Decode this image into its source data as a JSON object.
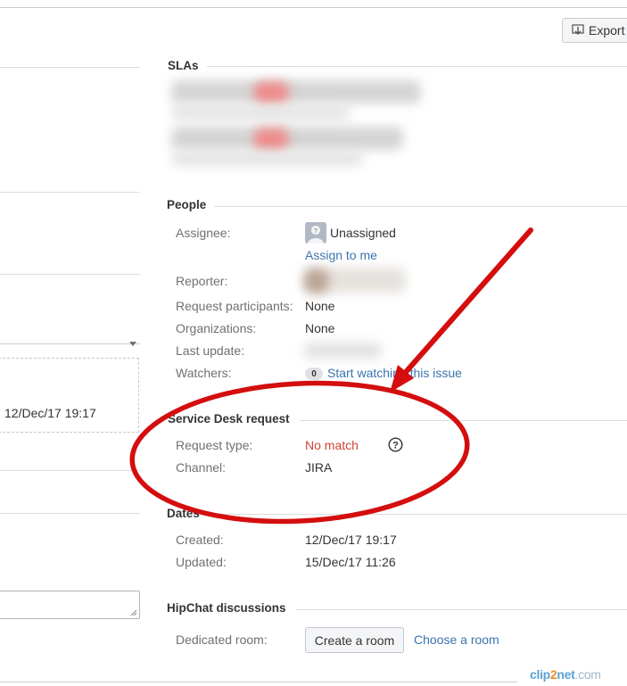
{
  "toolbar": {
    "export_label": "Export"
  },
  "left_panel": {
    "visible_date": "12/Dec/17 19:17"
  },
  "sections": {
    "slas": {
      "title": "SLAs"
    },
    "people": {
      "title": "People",
      "assignee_label": "Assignee:",
      "assignee_value": "Unassigned",
      "assign_to_me": "Assign to me",
      "reporter_label": "Reporter:",
      "participants_label": "Request participants:",
      "participants_value": "None",
      "organizations_label": "Organizations:",
      "organizations_value": "None",
      "last_update_label": "Last update:",
      "watchers_label": "Watchers:",
      "watchers_count": "0",
      "watch_link": "Start watching this issue"
    },
    "service_desk": {
      "title": "Service Desk request",
      "request_type_label": "Request type:",
      "request_type_value": "No match",
      "channel_label": "Channel:",
      "channel_value": "JIRA"
    },
    "dates": {
      "title": "Dates",
      "created_label": "Created:",
      "created_value": "12/Dec/17 19:17",
      "updated_label": "Updated:",
      "updated_value": "15/Dec/17 11:26"
    },
    "hipchat": {
      "title": "HipChat discussions",
      "room_label": "Dedicated room:",
      "create_room": "Create a room",
      "choose_room": "Choose a room"
    }
  },
  "watermark": {
    "part1": "clip",
    "part2": "2",
    "part3": "net",
    "part4": ".com"
  },
  "colors": {
    "link": "#3b73af",
    "no_match": "#d04437",
    "annotation": "#d40e0e"
  },
  "icons": [
    "export-icon",
    "avatar-icon",
    "help-icon",
    "resize-grip-icon"
  ]
}
